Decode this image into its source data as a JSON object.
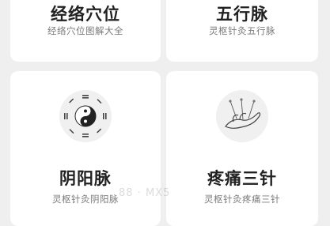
{
  "cards": [
    {
      "title": "经络穴位",
      "subtitle": "经络穴位图解大全"
    },
    {
      "title": "五行脉",
      "subtitle": "灵枢针灸五行脉"
    },
    {
      "title": "阴阳脉",
      "subtitle": "灵枢针灸阴阳脉",
      "icon": "yin-yang-bagua-icon"
    },
    {
      "title": "疼痛三针",
      "subtitle": "灵枢针灸疼痛三针",
      "icon": "acupuncture-hand-icon"
    }
  ],
  "watermark": "88 · MX5"
}
